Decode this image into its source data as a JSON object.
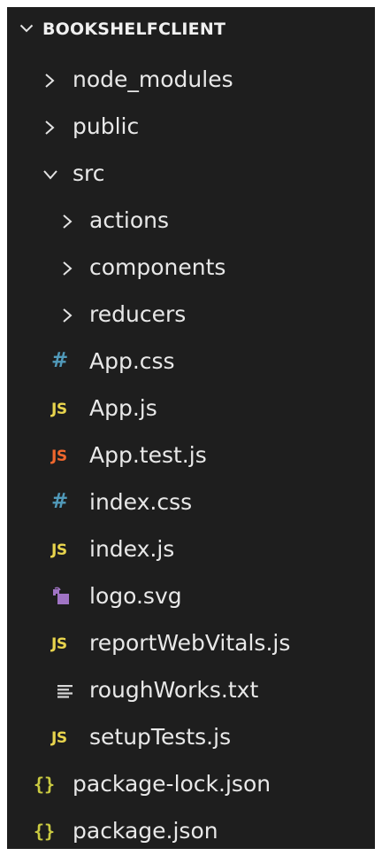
{
  "explorer": {
    "root_title": "BOOKSHELFCLIENT",
    "items": [
      {
        "label": "node_modules",
        "kind": "folder",
        "expanded": false,
        "icon": "chevron-right-icon"
      },
      {
        "label": "public",
        "kind": "folder",
        "expanded": false,
        "icon": "chevron-right-icon"
      },
      {
        "label": "src",
        "kind": "folder",
        "expanded": true,
        "icon": "chevron-down-icon"
      },
      {
        "label": "actions",
        "kind": "folder",
        "expanded": false,
        "icon": "chevron-right-icon"
      },
      {
        "label": "components",
        "kind": "folder",
        "expanded": false,
        "icon": "chevron-right-icon"
      },
      {
        "label": "reducers",
        "kind": "folder",
        "expanded": false,
        "icon": "chevron-right-icon"
      },
      {
        "label": "App.css",
        "kind": "file",
        "icon": "css-file-icon",
        "icon_text": "#"
      },
      {
        "label": "App.js",
        "kind": "file",
        "icon": "js-file-icon",
        "icon_text": "JS"
      },
      {
        "label": "App.test.js",
        "kind": "file",
        "icon": "js-test-file-icon",
        "icon_text": "JS"
      },
      {
        "label": "index.css",
        "kind": "file",
        "icon": "css-file-icon",
        "icon_text": "#"
      },
      {
        "label": "index.js",
        "kind": "file",
        "icon": "js-file-icon",
        "icon_text": "JS"
      },
      {
        "label": "logo.svg",
        "kind": "file",
        "icon": "svg-file-icon"
      },
      {
        "label": "reportWebVitals.js",
        "kind": "file",
        "icon": "js-file-icon",
        "icon_text": "JS"
      },
      {
        "label": "roughWorks.txt",
        "kind": "file",
        "icon": "text-file-icon"
      },
      {
        "label": "setupTests.js",
        "kind": "file",
        "icon": "js-file-icon",
        "icon_text": "JS"
      },
      {
        "label": "package-lock.json",
        "kind": "file",
        "icon": "json-file-icon",
        "icon_text": "{}"
      },
      {
        "label": "package.json",
        "kind": "file",
        "icon": "json-file-icon",
        "icon_text": "{}"
      }
    ]
  },
  "colors": {
    "background": "#1e1e1e",
    "text": "#e8e8e8",
    "js": "#e8d44d",
    "js_test": "#f0672d",
    "css": "#519aba",
    "json": "#cbcb41",
    "svg": "#a074c4"
  }
}
